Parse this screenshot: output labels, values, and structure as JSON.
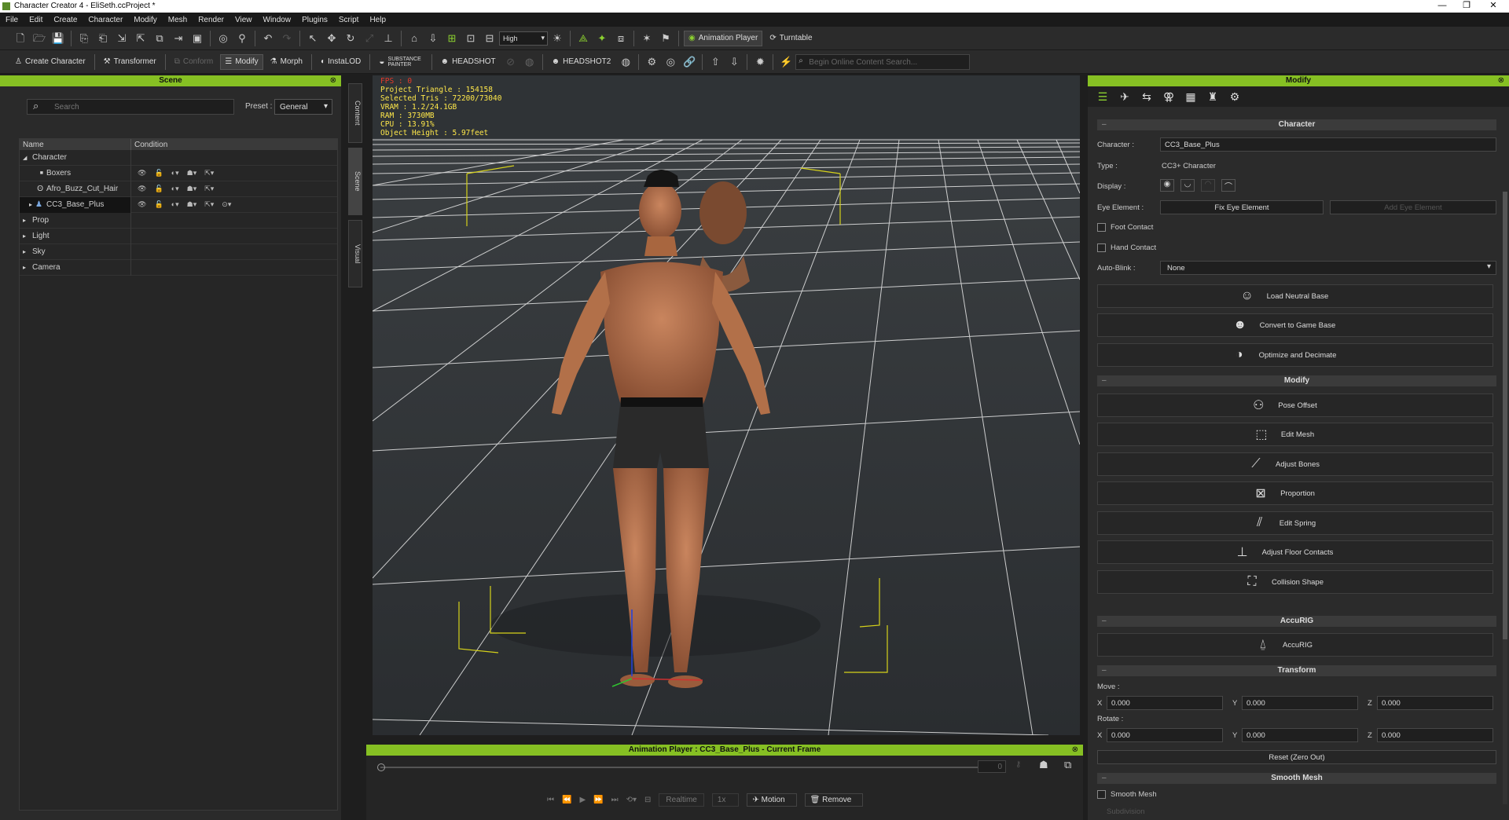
{
  "window": {
    "title": "Character Creator 4 - EliSeth.ccProject *",
    "minimize": "—",
    "maximize": "❐",
    "close": "✕"
  },
  "menu": [
    "File",
    "Edit",
    "Create",
    "Character",
    "Modify",
    "Mesh",
    "Render",
    "View",
    "Window",
    "Plugins",
    "Script",
    "Help"
  ],
  "toolbar1": {
    "quality": "High",
    "animation_player": "Animation Player",
    "turntable": "Turntable"
  },
  "toolbar2": {
    "create_character": "Create Character",
    "transformer": "Transformer",
    "conform": "Conform",
    "modify": "Modify",
    "morph": "Morph",
    "instalod": "InstaLOD",
    "substance": "SUBSTANCE PAINTER",
    "headshot": "HEADSHOT",
    "headshot2": "HEADSHOT2",
    "online_search_placeholder": "Begin Online Content Search..."
  },
  "scene": {
    "title": "Scene",
    "search_placeholder": "Search",
    "preset_label": "Preset :",
    "preset_value": "General",
    "columns": [
      "Name",
      "Condition"
    ],
    "items": [
      {
        "label": "Character",
        "arrow": "◢",
        "icon": ""
      },
      {
        "label": "Boxers",
        "arrow": "",
        "icon": "■"
      },
      {
        "label": "Afro_Buzz_Cut_Hair",
        "arrow": "",
        "icon": "ʘ"
      },
      {
        "label": "CC3_Base_Plus",
        "arrow": "▸",
        "icon": "♟"
      },
      {
        "label": "Prop",
        "arrow": "▸",
        "icon": ""
      },
      {
        "label": "Light",
        "arrow": "▸",
        "icon": ""
      },
      {
        "label": "Sky",
        "arrow": "▸",
        "icon": ""
      },
      {
        "label": "Camera",
        "arrow": "▸",
        "icon": ""
      }
    ]
  },
  "side_tabs": [
    "Content",
    "Scene",
    "Visual"
  ],
  "viewport_stats": {
    "fps": "FPS : 0",
    "triangles": "Project Triangle : 154158",
    "selected": "Selected Tris : 72200/73040",
    "vram": "VRAM : 1.2/24.1GB",
    "ram": "RAM : 3730MB",
    "cpu": "CPU : 13.91%",
    "height": "Object Height : 5.97feet"
  },
  "anim_player": {
    "title": "Animation Player : CC3_Base_Plus - Current Frame",
    "frame": "0",
    "realtime": "Realtime",
    "speed": "1x",
    "motion": "Motion",
    "remove": "Remove"
  },
  "modify": {
    "title": "Modify",
    "character_section": "Character",
    "character_label": "Character :",
    "character_value": "CC3_Base_Plus",
    "type_label": "Type :",
    "type_value": "CC3+ Character",
    "display_label": "Display :",
    "eye_label": "Eye Element :",
    "fix_eye": "Fix Eye Element",
    "add_eye": "Add Eye Element",
    "foot_contact": "Foot Contact",
    "hand_contact": "Hand Contact",
    "autoblink_label": "Auto-Blink :",
    "autoblink_value": "None",
    "load_neutral": "Load Neutral Base",
    "convert_game": "Convert to Game Base",
    "optimize": "Optimize and Decimate",
    "modify_section": "Modify",
    "pose_offset": "Pose Offset",
    "edit_mesh": "Edit Mesh",
    "adjust_bones": "Adjust Bones",
    "proportion": "Proportion",
    "edit_spring": "Edit Spring",
    "floor_contacts": "Adjust Floor Contacts",
    "collision": "Collision Shape",
    "accurig_section": "AccuRIG",
    "accurig": "AccuRIG",
    "transform_section": "Transform",
    "move_label": "Move :",
    "rotate_label": "Rotate :",
    "x": "X",
    "y": "Y",
    "z": "Z",
    "move": {
      "x": "0.000",
      "y": "0.000",
      "z": "0.000"
    },
    "rotate": {
      "x": "0.000",
      "y": "0.000",
      "z": "0.000"
    },
    "reset": "Reset (Zero Out)",
    "smooth_section": "Smooth Mesh",
    "smooth_mesh": "Smooth Mesh",
    "subdivision": "Subdivision"
  },
  "colors": {
    "accent": "#86c023"
  }
}
